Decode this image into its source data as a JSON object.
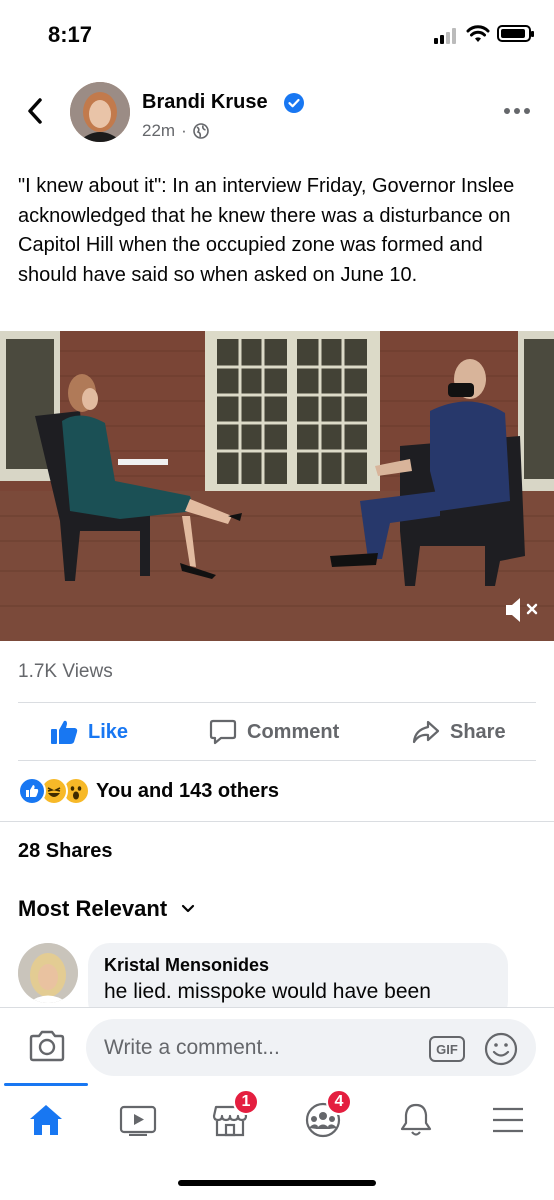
{
  "status_bar": {
    "time": "8:17"
  },
  "post": {
    "author": "Brandi Kruse",
    "time_ago": "22m",
    "separator": "·",
    "text": "\"I knew about it\": In an interview Friday, Governor Inslee acknowledged that he knew there was a disturbance on Capitol Hill when the occupied zone was formed and should have said so when asked on June 10.",
    "views": "1.7K Views"
  },
  "actions": {
    "like": "Like",
    "comment": "Comment",
    "share": "Share"
  },
  "reactions": {
    "icons": [
      "like-reaction-icon",
      "haha-reaction-icon",
      "wow-reaction-icon"
    ],
    "summary": "You and 143 others"
  },
  "shares": "28 Shares",
  "comments": {
    "sort_label": "Most Relevant",
    "items": [
      {
        "name": "Kristal Mensonides",
        "text": "he lied. misspoke would have been"
      }
    ]
  },
  "composer": {
    "placeholder": "Write a comment...",
    "gif_label": "GIF"
  },
  "tab_bar": {
    "tabs": [
      "home-icon",
      "watch-icon",
      "marketplace-icon",
      "groups-icon",
      "notifications-icon",
      "menu-icon"
    ],
    "marketplace_badge": "1",
    "groups_badge": "4"
  },
  "colors": {
    "accent": "#1877f2",
    "secondary_text": "#65676b",
    "badge": "#e41e3f"
  }
}
